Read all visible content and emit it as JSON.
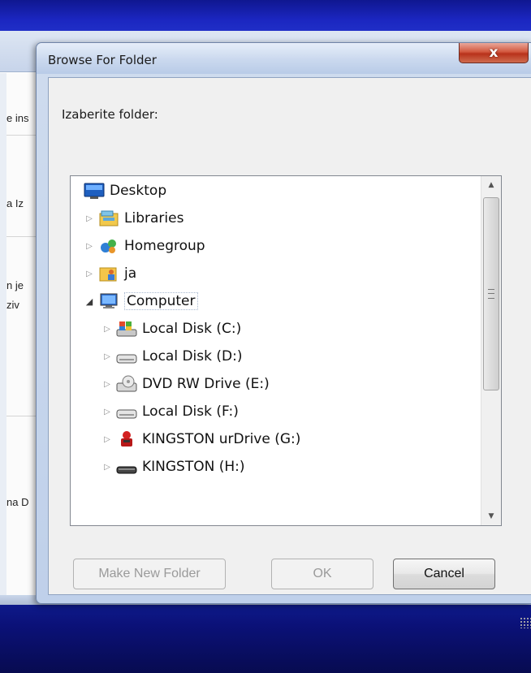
{
  "background_window": {
    "fragments": [
      "e ins",
      "a Iz",
      "n je",
      "ziv",
      "na D"
    ]
  },
  "dialog": {
    "title": "Browse For Folder",
    "close_glyph": "x",
    "prompt": "Izaberite folder:",
    "tree": [
      {
        "label": "Desktop",
        "icon": "desktop-icon",
        "level": 0,
        "expander": ""
      },
      {
        "label": "Libraries",
        "icon": "libraries-icon",
        "level": 1,
        "expander": "▷"
      },
      {
        "label": "Homegroup",
        "icon": "homegroup-icon",
        "level": 1,
        "expander": "▷"
      },
      {
        "label": "ja",
        "icon": "user-folder-icon",
        "level": 1,
        "expander": "▷"
      },
      {
        "label": "Computer",
        "icon": "computer-icon",
        "level": 1,
        "expander": "◢"
      },
      {
        "label": "Local Disk (C:)",
        "icon": "system-drive-icon",
        "level": 2,
        "expander": "▷"
      },
      {
        "label": "Local Disk (D:)",
        "icon": "hard-drive-icon",
        "level": 2,
        "expander": "▷"
      },
      {
        "label": "DVD RW Drive (E:)",
        "icon": "dvd-drive-icon",
        "level": 2,
        "expander": "▷"
      },
      {
        "label": "Local Disk (F:)",
        "icon": "hard-drive-icon",
        "level": 2,
        "expander": "▷"
      },
      {
        "label": "KINGSTON urDrive (G:)",
        "icon": "kingston-icon",
        "level": 2,
        "expander": "▷"
      },
      {
        "label": "KINGSTON (H:)",
        "icon": "usb-drive-icon",
        "level": 2,
        "expander": "▷"
      }
    ],
    "scrollbar": {
      "up_glyph": "▲",
      "down_glyph": "▼"
    },
    "buttons": {
      "make_new_folder": "Make New Folder",
      "ok": "OK",
      "cancel": "Cancel"
    }
  },
  "colors": {
    "desktop_blue": "#1a20a8",
    "close_red": "#c9452c",
    "tree_border": "#828790"
  }
}
